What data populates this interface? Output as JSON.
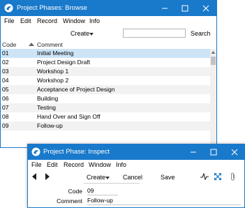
{
  "browse": {
    "title": "Project Phases: Browse",
    "menu": [
      "File",
      "Edit",
      "Record",
      "Window",
      "Info"
    ],
    "create_label": "Create",
    "search_label": "Search",
    "search_value": "",
    "columns": {
      "code": "Code",
      "comment": "Comment"
    },
    "rows": [
      {
        "code": "01",
        "comment": "Initial Meeting"
      },
      {
        "code": "02",
        "comment": "Project Design Draft"
      },
      {
        "code": "03",
        "comment": "Workshop 1"
      },
      {
        "code": "04",
        "comment": "Workshop 2"
      },
      {
        "code": "05",
        "comment": "Acceptance of Project Design"
      },
      {
        "code": "06",
        "comment": "Building"
      },
      {
        "code": "07",
        "comment": "Testing"
      },
      {
        "code": "08",
        "comment": "Hand Over and Sign Off"
      },
      {
        "code": "09",
        "comment": "Follow-up"
      }
    ]
  },
  "inspect": {
    "title": "Project Phase: Inspect",
    "menu": [
      "File",
      "Edit",
      "Record",
      "Window",
      "Info"
    ],
    "create_label": "Create",
    "cancel_label": "Cancel",
    "save_label": "Save",
    "fields": {
      "code_label": "Code",
      "code_value": "09",
      "comment_label": "Comment",
      "comment_value": "Follow-up"
    }
  },
  "colors": {
    "titlebar": "#1979ca",
    "selected_row": "#cde4f7",
    "alt_row": "#f2f2f2"
  }
}
